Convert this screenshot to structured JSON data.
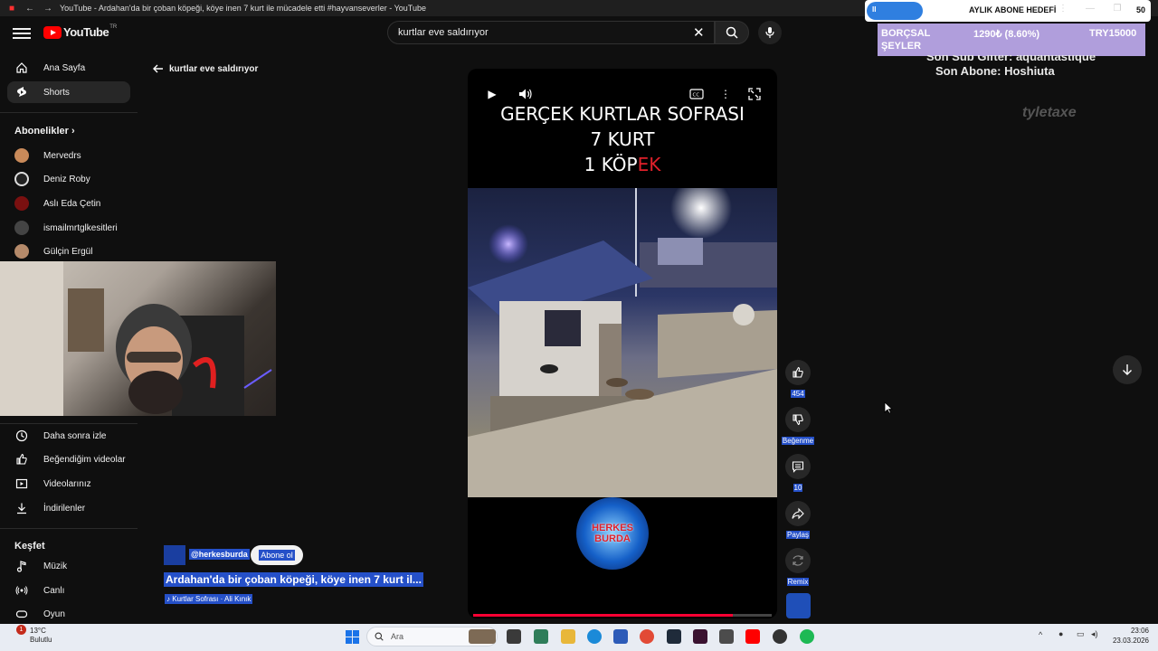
{
  "browser": {
    "tab_title": "YouTube - Ardahan'da bir çoban köpeği, köye inen 7 kurt ile mücadele etti #hayvanseverler - YouTube"
  },
  "stream_overlay": {
    "goal_label": "AYLIK ABONE HEDEFİ",
    "goal_count": "50",
    "goal_pause_icon": "II",
    "donation_name": "BORÇSAL ŞEYLER",
    "donation_progress": "1290₺ (8.60%)",
    "donation_goal": "TRY15000",
    "last_sub_gifter": "Son Sub Gifter: aquantastique",
    "last_subscriber": "Son Abone: Hoshiuta",
    "sponsor_text": "tyletaxe",
    "goal_progress_fraction": 0.2
  },
  "header": {
    "logo_text": "YouTube",
    "logo_region": "TR",
    "search_value": "kurtlar eve saldırıyor"
  },
  "sidebar": {
    "main": [
      {
        "label": "Ana Sayfa",
        "icon": "home-icon"
      },
      {
        "label": "Shorts",
        "icon": "shorts-icon"
      }
    ],
    "subscriptions_heading": "Abonelikler",
    "subscriptions": [
      {
        "label": "Mervedrs",
        "color": "#c98a5a"
      },
      {
        "label": "Deniz Roby",
        "color": "#222222"
      },
      {
        "label": "Aslı Eda Çetin",
        "color": "#7a1010"
      },
      {
        "label": "ismailmrtglkesitleri",
        "color": "#444444"
      },
      {
        "label": "Gülçin Ergül",
        "color": "#b58a6a"
      }
    ],
    "you": [
      {
        "label": "Daha sonra izle",
        "icon": "clock-icon"
      },
      {
        "label": "Beğendiğim videolar",
        "icon": "thumb-up-icon"
      },
      {
        "label": "Videolarınız",
        "icon": "video-icon"
      },
      {
        "label": "İndirilenler",
        "icon": "download-icon"
      }
    ],
    "explore_heading": "Keşfet",
    "explore": [
      {
        "label": "Müzik",
        "icon": "music-icon"
      },
      {
        "label": "Canlı",
        "icon": "live-icon"
      },
      {
        "label": "Oyun",
        "icon": "game-icon"
      }
    ]
  },
  "back_link": "kurtlar eve saldırıyor",
  "player": {
    "overlay_line1": "GERÇEK KURTLAR SOFRASI",
    "overlay_line2": "7 KURT",
    "overlay_line3_white": "1 KÖP",
    "overlay_line3_red": "EK",
    "badge_line1": "HERKES",
    "badge_line2": "BURDA",
    "progress_fraction": 0.87
  },
  "short_info": {
    "channel_handle": "@herkesburda",
    "subscribe_label": "Abone ol",
    "title": "Ardahan'da bir çoban köpeği, köye inen 7 kurt il...",
    "sound": "Kurtlar Sofrası · Ali Kınık"
  },
  "actions": {
    "like_count": "454",
    "dislike_label": "Beğenme",
    "comment_count": "10",
    "share_label": "Paylaş",
    "remix_label": "Remix"
  },
  "taskbar": {
    "temperature": "13°C",
    "weather": "Bulutlu",
    "notification_count": "1",
    "search_placeholder": "Ara",
    "time": "23:06",
    "date": "23.03.2026"
  }
}
